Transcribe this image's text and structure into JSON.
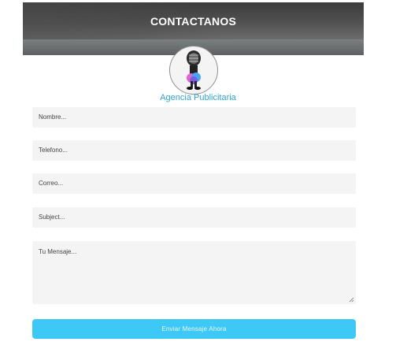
{
  "header": {
    "title": "CONTACTANOS"
  },
  "brand": {
    "agency_name": "Agencia Publicitaria",
    "logo_icon": "microphone-logo-icon"
  },
  "form": {
    "fields": [
      {
        "placeholder": "Nombre..."
      },
      {
        "placeholder": "Telefono..."
      },
      {
        "placeholder": "Correo..."
      },
      {
        "placeholder": "Subject..."
      }
    ],
    "message_placeholder": "Tu Mensaje...",
    "submit_label": "Enviar Mensaje Ahora"
  },
  "colors": {
    "accent": "#3ec8f5",
    "agency_text": "#2aa6d6",
    "field_bg": "#f4f4f4"
  }
}
